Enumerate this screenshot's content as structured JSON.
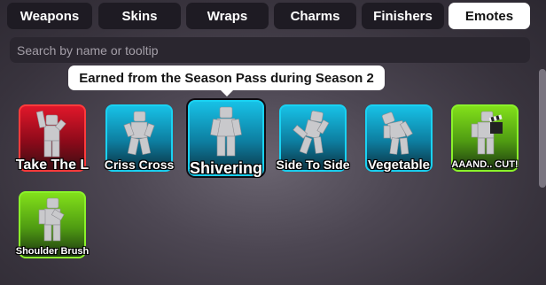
{
  "tabs": [
    {
      "label": "Weapons",
      "active": false
    },
    {
      "label": "Skins",
      "active": false
    },
    {
      "label": "Wraps",
      "active": false
    },
    {
      "label": "Charms",
      "active": false
    },
    {
      "label": "Finishers",
      "active": false
    },
    {
      "label": "Emotes",
      "active": true
    }
  ],
  "search": {
    "placeholder": "Search by name or tooltip",
    "value": ""
  },
  "tooltip": {
    "text": "Earned from the Season Pass during Season 2"
  },
  "emotes": [
    {
      "name": "Take The L",
      "rarity": "red",
      "figure": "figure-take-the-l"
    },
    {
      "name": "Criss Cross",
      "rarity": "blue",
      "figure": "figure-criss-cross"
    },
    {
      "name": "Shivering",
      "rarity": "blue",
      "figure": "figure-shivering",
      "selected": true
    },
    {
      "name": "Side To Side",
      "rarity": "blue",
      "figure": "figure-side-to-side"
    },
    {
      "name": "Vegetable",
      "rarity": "blue",
      "figure": "figure-vegetable"
    },
    {
      "name": "AAAND.. CUT!",
      "rarity": "green",
      "figure": "figure-clapperboard"
    },
    {
      "name": "Shoulder Brush",
      "rarity": "green",
      "figure": "figure-shoulder-brush"
    }
  ],
  "colors": {
    "red": "#e0172a",
    "blue": "#17c1e6",
    "green": "#82e01a",
    "tab_bg": "#1e1b23",
    "tab_active_bg": "#ffffff"
  }
}
